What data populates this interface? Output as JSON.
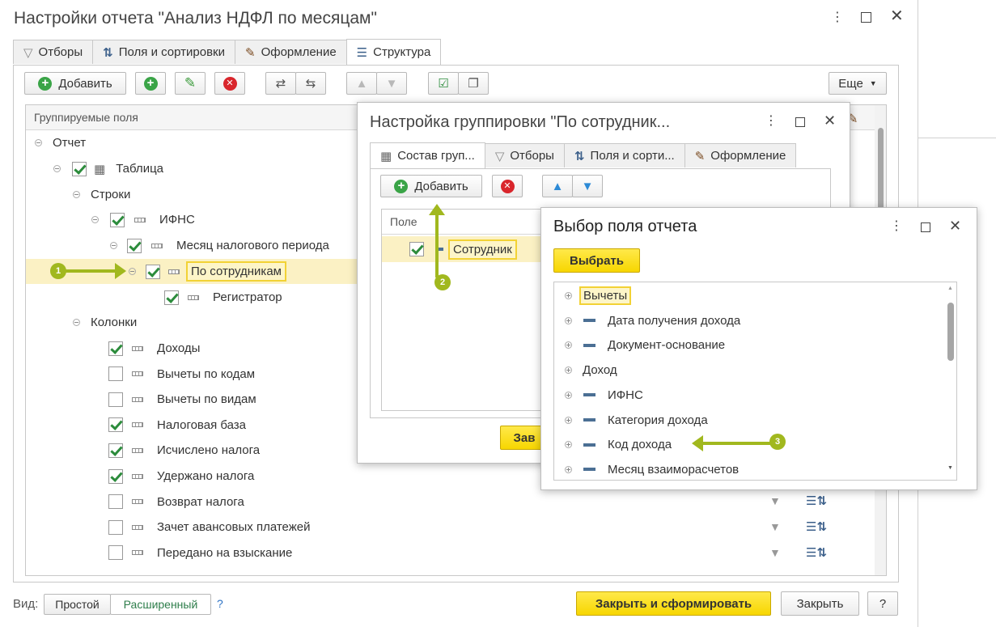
{
  "main": {
    "title": "Настройки отчета \"Анализ НДФЛ по месяцам\"",
    "tabs": [
      "Отборы",
      "Поля и сортировки",
      "Оформление",
      "Структура"
    ],
    "toolbar": {
      "add": "Добавить",
      "more": "Еще"
    },
    "grid_header": "Группируемые поля",
    "tree": [
      "Отчет",
      "Таблица",
      "Строки",
      "ИФНС",
      "Месяц налогового периода",
      "По сотрудникам",
      "Регистратор",
      "Колонки"
    ],
    "columns": [
      {
        "label": "Доходы",
        "checked": true
      },
      {
        "label": "Вычеты по кодам",
        "checked": false
      },
      {
        "label": "Вычеты по видам",
        "checked": false
      },
      {
        "label": "Налоговая база",
        "checked": true
      },
      {
        "label": "Исчислено налога",
        "checked": true
      },
      {
        "label": "Удержано налога",
        "checked": true
      },
      {
        "label": "Возврат налога",
        "checked": false
      },
      {
        "label": "Зачет авансовых платежей",
        "checked": false
      },
      {
        "label": "Передано на взыскание",
        "checked": false
      }
    ],
    "footer": {
      "view_label": "Вид:",
      "simple": "Простой",
      "extended": "Расширенный",
      "help": "?",
      "generate": "Закрыть и сформировать",
      "close": "Закрыть",
      "question": "?"
    }
  },
  "grouping": {
    "title": "Настройка группировки \"По сотрудник...",
    "tabs": [
      "Состав груп...",
      "Отборы",
      "Поля и сорти...",
      "Оформление"
    ],
    "add": "Добавить",
    "col_header": "Поле",
    "field": "Сотрудник",
    "save_partial": "Зав"
  },
  "picker": {
    "title": "Выбор поля отчета",
    "select": "Выбрать",
    "items": [
      {
        "label": "Вычеты",
        "type": "group"
      },
      {
        "label": "Дата получения дохода",
        "type": "field"
      },
      {
        "label": "Документ-основание",
        "type": "field"
      },
      {
        "label": "Доход",
        "type": "group"
      },
      {
        "label": "ИФНС",
        "type": "field"
      },
      {
        "label": "Категория дохода",
        "type": "field"
      },
      {
        "label": "Код дохода",
        "type": "field"
      },
      {
        "label": "Месяц взаиморасчетов",
        "type": "field"
      }
    ]
  },
  "markers": [
    "1",
    "2",
    "3"
  ],
  "colors": {
    "accent_yellow": "#f7d600",
    "highlight_row": "#fbf1c4",
    "marker_green": "#a1b81e",
    "check_green": "#2c8c3c"
  }
}
